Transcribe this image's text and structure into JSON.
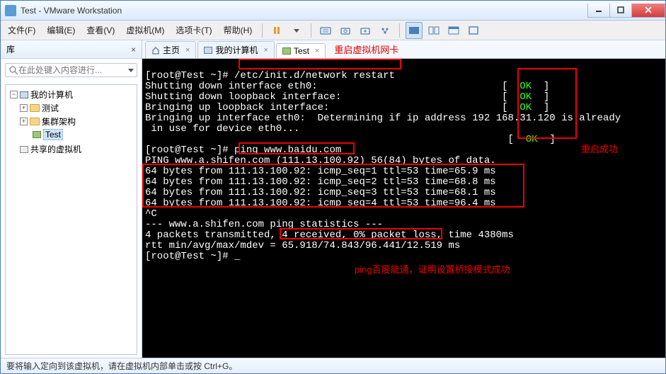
{
  "title": "Test - VMware Workstation",
  "menu": [
    "文件(F)",
    "编辑(E)",
    "查看(V)",
    "虚拟机(M)",
    "选项卡(T)",
    "帮助(H)"
  ],
  "library": {
    "header": "库",
    "close": "×",
    "search_placeholder": "在此处键入内容进行...",
    "root": "我的计算机",
    "items": [
      "测试",
      "集群架构",
      "Test"
    ],
    "shared": "共享的虚拟机"
  },
  "tabs": [
    {
      "icon": "home",
      "label": "主页"
    },
    {
      "icon": "pc",
      "label": "我的计算机"
    },
    {
      "icon": "pc",
      "label": "Test"
    }
  ],
  "annotations": {
    "restart_label": "重启虚拟机网卡",
    "restart_ok": "重启成功",
    "ping_label": "ping百度能通，证明设置桥接模式成功"
  },
  "terminal": {
    "prompt": "[root@Test ~]# ",
    "cmd_restart": "/etc/init.d/network restart",
    "l2": "Shutting down interface eth0:",
    "l3": "Shutting down loopback interface:",
    "l4": "Bringing up loopback interface:",
    "l5": "Bringing up interface eth0:  Determining if ip address 192",
    "l5b": "168.31.120 is already",
    "l6": " in use for device eth0...",
    "ok_open": "[  ",
    "ok": "OK",
    "ok_close": "  ]",
    "cmd_ping": "ping www.baidu.com",
    "p1": "PING www.a.shifen.com (111.13.100.92) 56(84) bytes of data.",
    "p2": "64 bytes from 111.13.100.92: icmp_seq=1 ttl=53 time=65.9 ms",
    "p3": "64 bytes from 111.13.100.92: icmp_seq=2 ttl=53 time=68.8 ms",
    "p4": "64 bytes from 111.13.100.92: icmp_seq=3 ttl=53 time=68.1 ms",
    "p5": "64 bytes from 111.13.100.92: icmp_seq=4 ttl=53 time=96.4 ms",
    "pc": "^C",
    "s1": "--- www.a.shifen.com ping statistics ---",
    "s2a": "4 packets transmitted, ",
    "s2b": "4 received, 0% packet loss",
    "s2c": ", time 4380ms",
    "s3": "rtt min/avg/max/mdev = 65.918/74.843/96.441/12.519 ms",
    "cursor": "_"
  },
  "status": "要将输入定向到该虚拟机，请在虚拟机内部单击或按 Ctrl+G。"
}
